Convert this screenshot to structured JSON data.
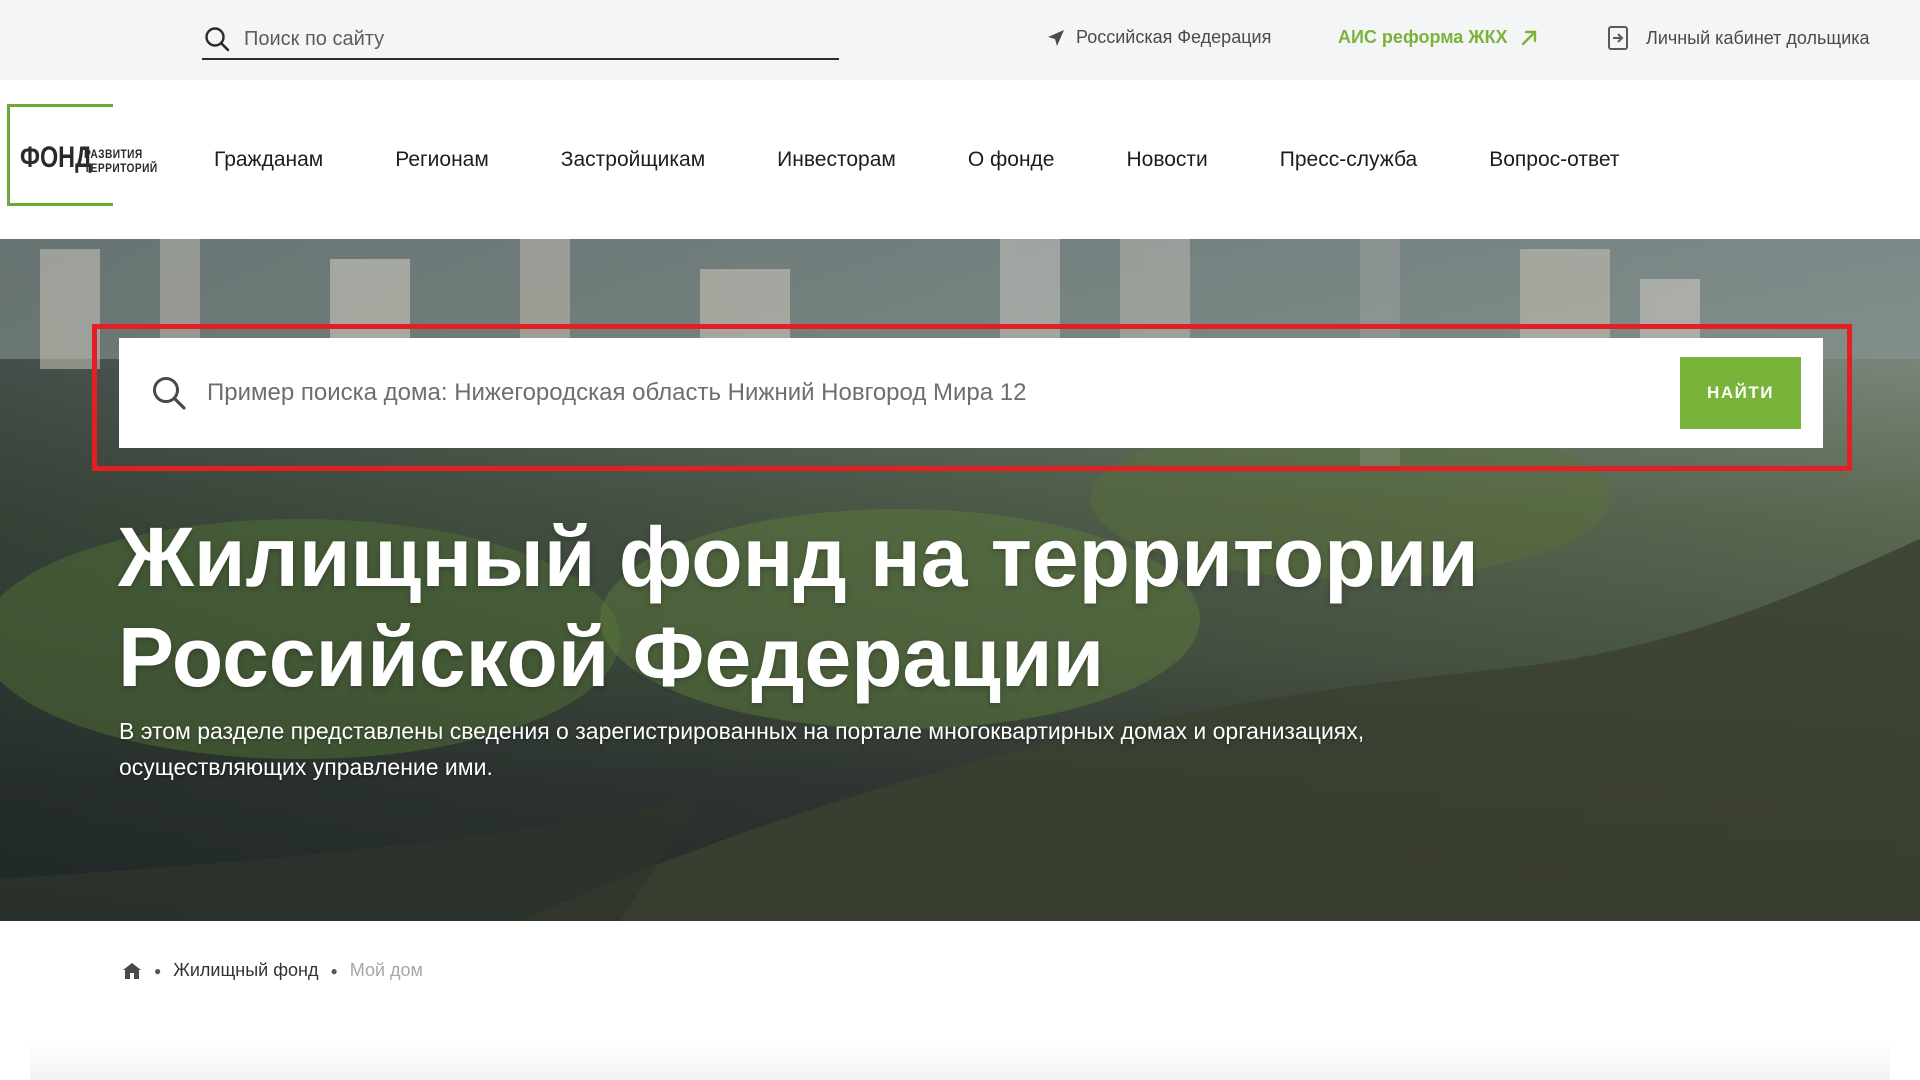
{
  "topbar": {
    "search_placeholder": "Поиск по сайту",
    "region_label": "Российская Федерация",
    "ais_label": "АИС реформа ЖКХ",
    "cabinet_label": "Личный кабинет дольщика"
  },
  "logo": {
    "main": "ФОНД",
    "sub_line1": "РАЗВИТИЯ",
    "sub_line2": "ТЕРРИТОРИЙ"
  },
  "nav": {
    "items": [
      {
        "label": "Гражданам"
      },
      {
        "label": "Регионам"
      },
      {
        "label": "Застройщикам"
      },
      {
        "label": "Инвесторам"
      },
      {
        "label": "О фонде"
      },
      {
        "label": "Новости"
      },
      {
        "label": "Пресс-служба"
      },
      {
        "label": "Вопрос-ответ"
      }
    ]
  },
  "hero": {
    "search_placeholder": "Пример поиска дома: Нижегородская область Нижний Новгород Мира 12",
    "search_button": "НАЙТИ",
    "title_line1": "Жилищный фонд на территории",
    "title_line2": "Российской Федерации",
    "description": "В этом разделе представлены сведения о зарегистрированных на портале многоквартирных домах и организациях, осуществляющих управление ими."
  },
  "breadcrumb": {
    "items": [
      {
        "label": "Жилищный фонд"
      },
      {
        "label": "Мой дом"
      }
    ]
  },
  "colors": {
    "accent_green": "#78b43a",
    "highlight_red": "#e41e25",
    "topbar_bg": "#f4f5f7"
  },
  "icons": [
    "search-icon",
    "location-arrow-icon",
    "external-arrow-icon",
    "login-icon",
    "home-icon"
  ]
}
